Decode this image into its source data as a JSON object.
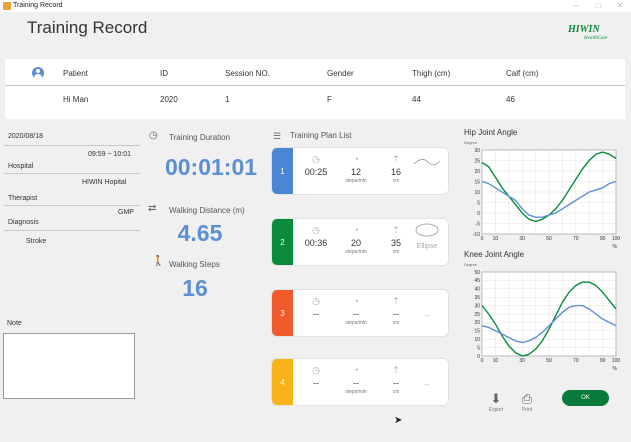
{
  "window": {
    "title": "Training Record",
    "controls": [
      "–",
      "□",
      "✕"
    ]
  },
  "header": {
    "title": "Training Record",
    "logo": "HIWIN",
    "logo_sub": "HealthCare"
  },
  "patient": {
    "headers": [
      "Patient",
      "ID",
      "Session NO.",
      "Gender",
      "Thigh (cm)",
      "Calf (cm)"
    ],
    "values": [
      "Hi   Man",
      "2020",
      "1",
      "F",
      "44",
      "46"
    ]
  },
  "info": {
    "date": "2020/08/18",
    "time": "09:59 ~ 10:01",
    "hospital_label": "Hospital",
    "hospital": "HIWIN Hopital",
    "therapist_label": "Therapist",
    "therapist": "GMP",
    "diagnosis_label": "Diagnosis",
    "diagnosis": "Stroke",
    "note_label": "Note",
    "note": ""
  },
  "metrics": {
    "duration_label": "Training Duration",
    "duration": "00:01:01",
    "distance_label": "Walking Distance (m)",
    "distance": "4.65",
    "steps_label": "Walking Steps",
    "steps": "16"
  },
  "plan": {
    "title": "Training Plan List",
    "steps_unit": "steps/min",
    "dist_unit": "cm",
    "items": [
      {
        "num": "1",
        "color": "#4a86d4",
        "time": "00:25",
        "speed": "12",
        "dist": "16",
        "shape": ""
      },
      {
        "num": "2",
        "color": "#0a8a3c",
        "time": "00:36",
        "speed": "20",
        "dist": "35",
        "shape": "Ellipse"
      },
      {
        "num": "3",
        "color": "#f15a2b",
        "time": "--",
        "speed": "--",
        "dist": "--",
        "shape": "--"
      },
      {
        "num": "4",
        "color": "#f8b31a",
        "time": "--",
        "speed": "--",
        "dist": "--",
        "shape": "--"
      }
    ]
  },
  "actions": {
    "export": "Export",
    "print": "Print",
    "ok": "OK"
  },
  "chart_data": [
    {
      "type": "line",
      "title": "Hip Joint Angle",
      "ylabel": "Degree",
      "xlabel": "%",
      "xlim": [
        0,
        100
      ],
      "ylim": [
        -10,
        30
      ],
      "xticks": [
        0,
        10,
        20,
        30,
        40,
        50,
        60,
        70,
        80,
        90,
        100
      ],
      "yticks": [
        -10,
        -5,
        0,
        5,
        10,
        15,
        20,
        25,
        30
      ],
      "grid": true,
      "series": [
        {
          "color": "#0a8a3c",
          "x": [
            0,
            5,
            10,
            15,
            20,
            25,
            30,
            35,
            40,
            45,
            50,
            55,
            60,
            65,
            70,
            75,
            80,
            85,
            90,
            95,
            100
          ],
          "y": [
            24,
            22,
            17,
            12,
            8,
            4,
            0,
            -3,
            -4,
            -3,
            -1,
            2,
            6,
            11,
            16,
            21,
            25,
            28,
            29,
            28,
            26
          ]
        },
        {
          "color": "#5d8fd4",
          "x": [
            0,
            5,
            10,
            15,
            20,
            25,
            30,
            35,
            40,
            45,
            50,
            55,
            60,
            65,
            70,
            75,
            80,
            85,
            90,
            95,
            100
          ],
          "y": [
            15,
            14,
            12,
            10,
            8,
            6,
            2,
            -1,
            -2,
            -2,
            -1,
            0,
            2,
            4,
            6,
            8,
            10,
            11,
            12,
            14,
            15
          ]
        }
      ]
    },
    {
      "type": "line",
      "title": "Knee Joint Angle",
      "ylabel": "Degree",
      "xlabel": "%",
      "xlim": [
        0,
        100
      ],
      "ylim": [
        0,
        50
      ],
      "xticks": [
        0,
        10,
        20,
        30,
        40,
        50,
        60,
        70,
        80,
        90,
        100
      ],
      "yticks": [
        0,
        5,
        10,
        15,
        20,
        25,
        30,
        35,
        40,
        45,
        50
      ],
      "grid": true,
      "series": [
        {
          "color": "#0a8a3c",
          "x": [
            0,
            5,
            10,
            15,
            20,
            25,
            30,
            35,
            40,
            45,
            50,
            55,
            60,
            65,
            70,
            75,
            80,
            85,
            90,
            95,
            100
          ],
          "y": [
            30,
            25,
            19,
            12,
            6,
            2,
            0,
            1,
            4,
            9,
            16,
            24,
            32,
            38,
            42,
            44,
            44,
            42,
            38,
            33,
            28
          ]
        },
        {
          "color": "#5d8fd4",
          "x": [
            0,
            5,
            10,
            15,
            20,
            25,
            30,
            35,
            40,
            45,
            50,
            55,
            60,
            65,
            70,
            75,
            80,
            85,
            90,
            95,
            100
          ],
          "y": [
            18,
            17,
            15,
            13,
            11,
            9,
            8,
            9,
            11,
            14,
            18,
            22,
            26,
            29,
            30,
            30,
            28,
            25,
            22,
            20,
            18
          ]
        }
      ]
    }
  ]
}
